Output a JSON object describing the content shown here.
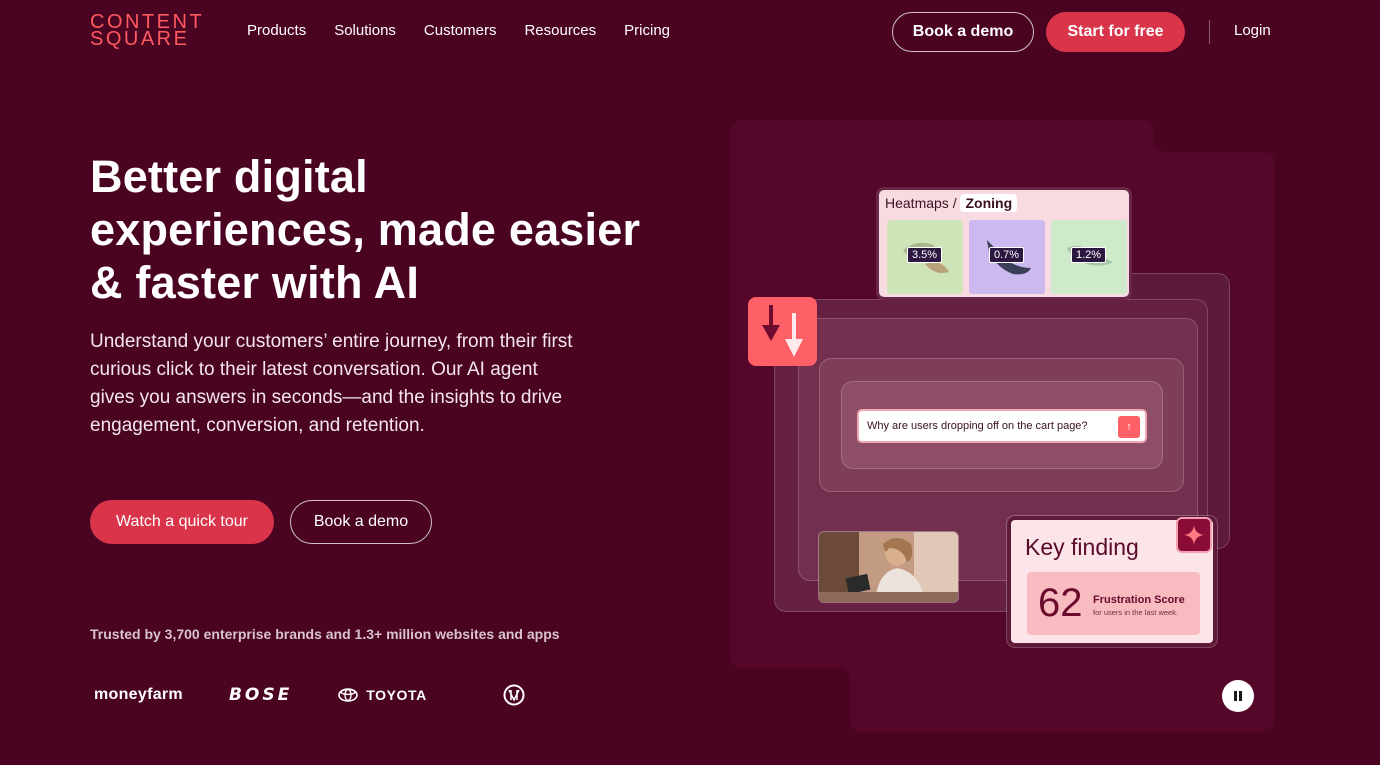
{
  "nav": {
    "logo_line1": "CONTENT",
    "logo_line2": "SQUARE",
    "links": [
      "Products",
      "Solutions",
      "Customers",
      "Resources",
      "Pricing"
    ],
    "book_demo": "Book a demo",
    "start_free": "Start for free",
    "login": "Login"
  },
  "hero": {
    "title": "Better digital experiences, made easier & faster with AI",
    "subtitle": "Understand your customers’ entire journey, from their first curious click to their latest conversation. Our AI agent gives you answers in seconds—and the insights to drive engagement, conversion, and retention.",
    "cta_tour": "Watch a quick tour",
    "cta_demo": "Book a demo",
    "trusted": "Trusted by 3,700 enterprise brands and 1.3+ million websites and apps"
  },
  "brands": {
    "moneyfarm": "moneyfarm",
    "bose": "BOSE",
    "toyota": "TOYOTA"
  },
  "visual": {
    "heatmap_prefix": "Heatmaps /",
    "heatmap_mode": "Zoning",
    "tiles": [
      "3.5%",
      "0.7%",
      "1.2%"
    ],
    "query": "Why are users dropping off on the cart page?",
    "query_send_icon": "↑",
    "key_title": "Key finding",
    "key_score": "62",
    "key_label": "Frustration Score",
    "key_desc": "for users in the last week."
  },
  "colors": {
    "background": "#4a0422",
    "accent_red": "#d9344a",
    "logo_coral": "#ff5a5f"
  }
}
